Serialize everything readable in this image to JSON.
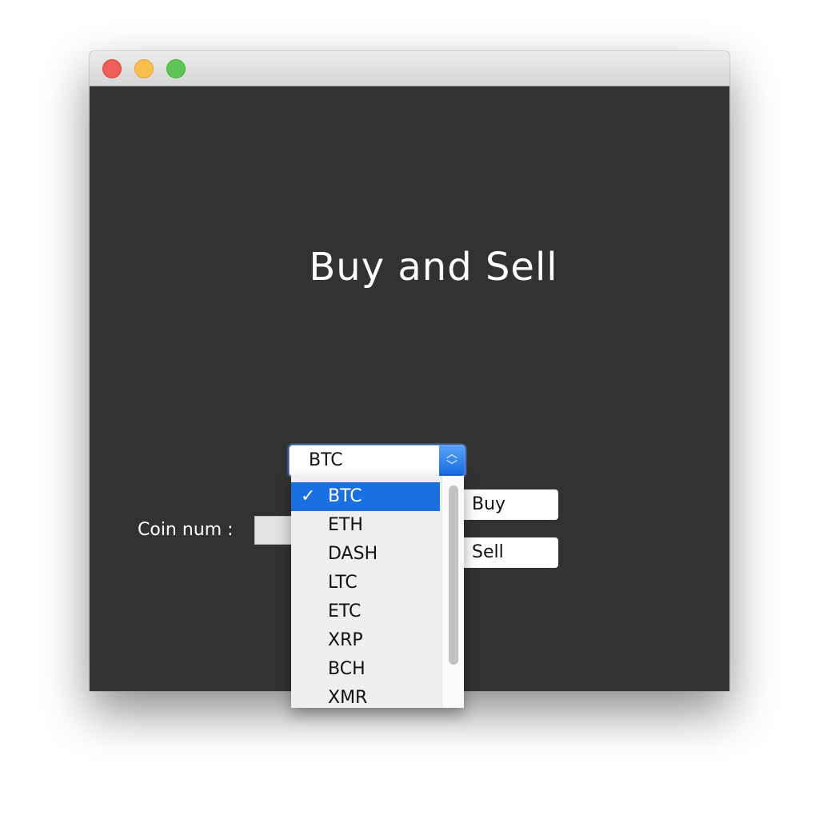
{
  "window": {
    "title": ""
  },
  "main": {
    "heading": "Buy and Sell",
    "coin_num_label": "Coin num :",
    "coin_num_value": "",
    "buy_label": "Buy",
    "sell_label": "Sell"
  },
  "coin_select": {
    "selected": "BTC",
    "options": [
      "BTC",
      "ETH",
      "DASH",
      "LTC",
      "ETC",
      "XRP",
      "BCH",
      "XMR"
    ],
    "selected_index": 0,
    "check_mark": "✓"
  },
  "colors": {
    "window_background": "#323232",
    "accent": "#1a6fe1",
    "close": "#ee5f58",
    "minimize": "#f9be4c",
    "maximize": "#5fc655"
  }
}
